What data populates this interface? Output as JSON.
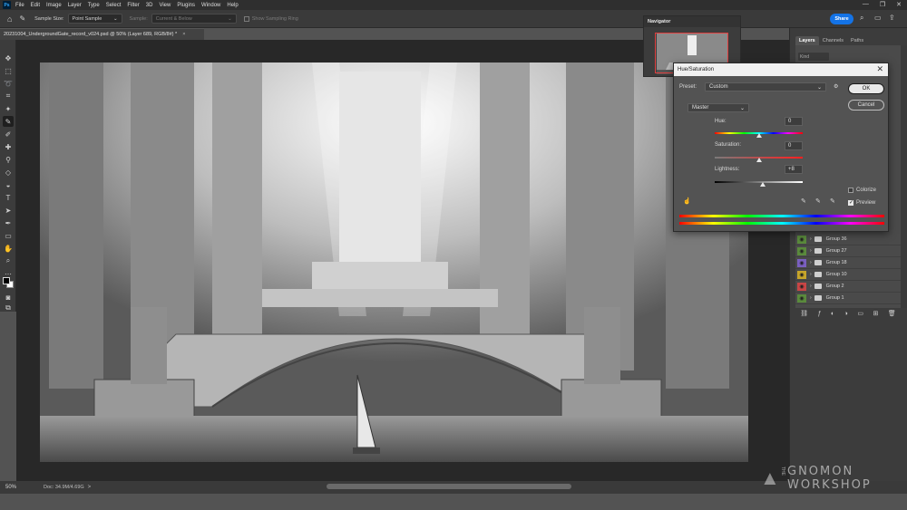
{
  "app": {
    "logo_text": "Ps"
  },
  "menu": [
    "File",
    "Edit",
    "Image",
    "Layer",
    "Type",
    "Select",
    "Filter",
    "3D",
    "View",
    "Plugins",
    "Window",
    "Help"
  ],
  "window_controls": [
    "—",
    "❐",
    "✕"
  ],
  "options_bar": {
    "sample_size_label": "Sample Size:",
    "sample_size_value": "Point Sample",
    "sample_label": "Sample:",
    "sample_value": "Current & Below",
    "show_ring_label": "Show Sampling Ring",
    "share_label": "Share"
  },
  "document": {
    "tab_title": "20231004_UndergroundGate_record_v024.psd @ 50% (Layer 689, RGB/8#) *",
    "close": "×"
  },
  "status": {
    "zoom": "50%",
    "doc_info": "Doc: 34.9M/4.69G",
    "arrow": ">"
  },
  "navigator": {
    "title": "Navigator"
  },
  "layers_panel": {
    "tabs": [
      "Layers",
      "Channels",
      "Paths"
    ],
    "search_placeholder": "Kind",
    "rows": [
      {
        "name": "Group 36",
        "color": "#5a8a3c"
      },
      {
        "name": "Group 27",
        "color": "#5a8a3c"
      },
      {
        "name": "Group 18",
        "color": "#7a5fc0"
      },
      {
        "name": "Group 10",
        "color": "#c7a52a"
      },
      {
        "name": "Group 2",
        "color": "#c84545"
      },
      {
        "name": "Group 1",
        "color": "#5a8a3c"
      }
    ]
  },
  "hue_saturation": {
    "title": "Hue/Saturation",
    "close": "✕",
    "preset_label": "Preset:",
    "preset_value": "Custom",
    "channel_value": "Master",
    "hue_label": "Hue:",
    "hue_value": "0",
    "saturation_label": "Saturation:",
    "saturation_value": "0",
    "lightness_label": "Lightness:",
    "lightness_value": "+8",
    "ok_label": "OK",
    "cancel_label": "Cancel",
    "colorize_label": "Colorize",
    "preview_label": "Preview",
    "colorize_checked": false,
    "preview_checked": true
  },
  "watermark": {
    "the": "THE",
    "line1": "GNOMON",
    "line2": "WORKSHOP"
  }
}
